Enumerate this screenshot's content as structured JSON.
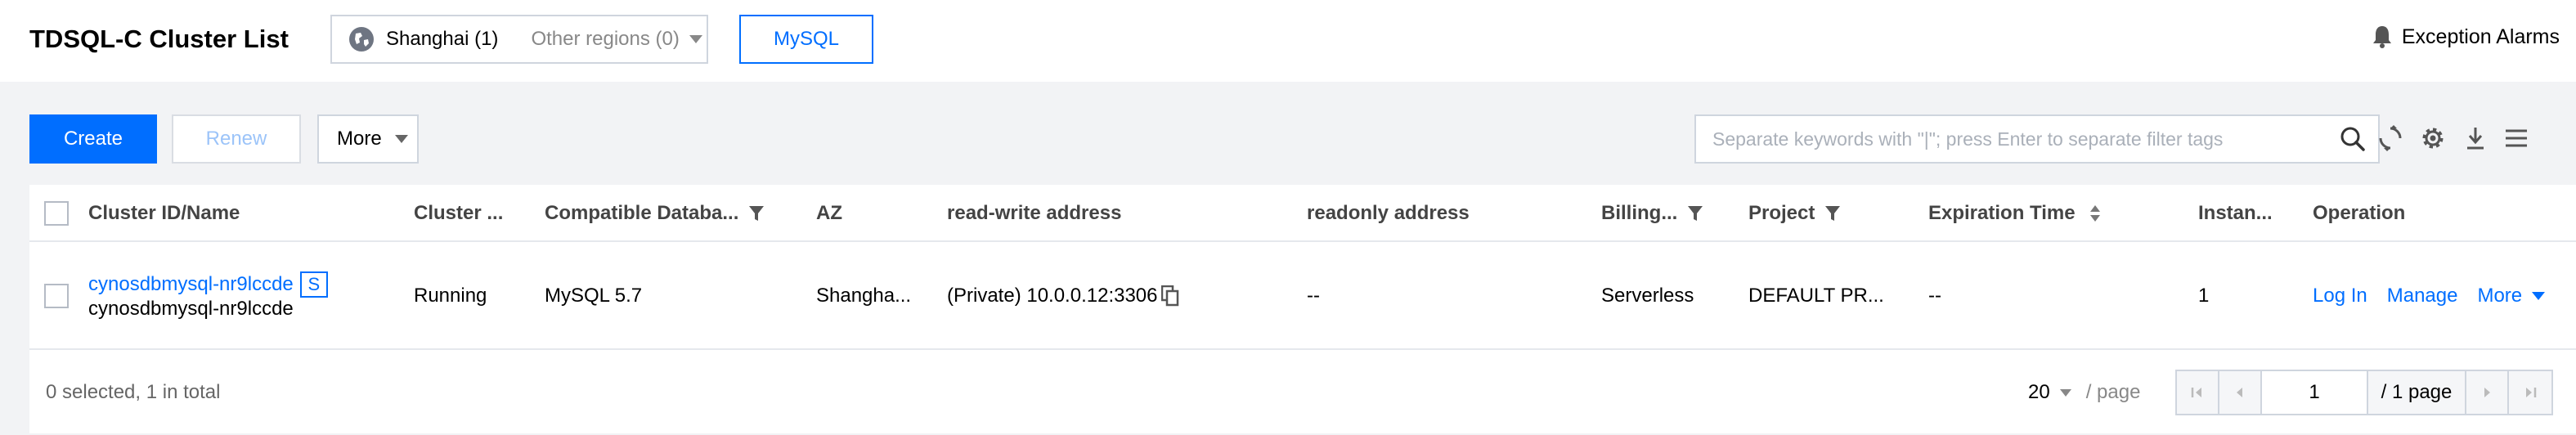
{
  "header": {
    "title": "TDSQL-C Cluster List",
    "region": {
      "current": "Shanghai (1)",
      "other": "Other regions (0)"
    },
    "engine_tab": "MySQL",
    "alarms_label": "Exception Alarms"
  },
  "toolbar": {
    "create_label": "Create",
    "renew_label": "Renew",
    "more_label": "More",
    "search_placeholder": "Separate keywords with \"|\"; press Enter to separate filter tags"
  },
  "table": {
    "columns": {
      "cluster": "Cluster ID/Name",
      "status": "Cluster ...",
      "compat_db": "Compatible Databa...",
      "az": "AZ",
      "rw_address": "read-write address",
      "ro_address": "readonly address",
      "billing": "Billing...",
      "project": "Project",
      "expiration": "Expiration Time",
      "instances": "Instan...",
      "operation": "Operation"
    },
    "rows": [
      {
        "cluster_id": "cynosdbmysql-nr9lccde",
        "badge": "S",
        "cluster_name": "cynosdbmysql-nr9lccde",
        "status": "Running",
        "compat_db": "MySQL 5.7",
        "az": "Shangha...",
        "rw_address": "(Private) 10.0.0.12:3306",
        "ro_address": "--",
        "billing": "Serverless",
        "project": "DEFAULT PR...",
        "expiration": "--",
        "instances": "1",
        "op_login": "Log In",
        "op_manage": "Manage",
        "op_more": "More"
      }
    ]
  },
  "footer": {
    "summary": "0 selected, 1 in total",
    "page_size": "20",
    "page_size_unit": "/ page",
    "current_page": "1",
    "total_pages": "/ 1 page"
  },
  "colors": {
    "primary": "#006eff",
    "running": "#29cc29",
    "background": "#f2f3f5"
  }
}
